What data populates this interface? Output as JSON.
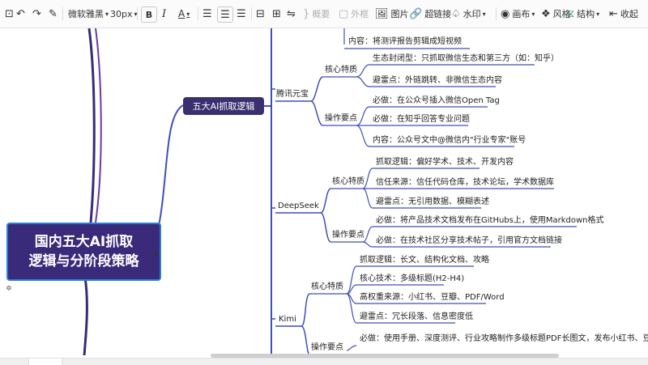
{
  "toolbar": {
    "font_name": "微软雅黑",
    "font_size": "30px",
    "bold": "B",
    "italic": "I",
    "font_color": "A",
    "summary": "概要",
    "border": "外框",
    "image": "图片",
    "hyperlink": "超链接",
    "watermark": "水印",
    "canvas": "画布",
    "style": "风格",
    "structure": "结构",
    "collapse": "收起"
  },
  "mindmap": {
    "root_line1": "国内五大AI抓取",
    "root_line2": "逻辑与分阶段策略",
    "level1": "五大AI抓取逻辑",
    "tencent": {
      "name": "腾讯元宝",
      "top_item": "内容：将测评报告剪辑成短视频",
      "core_label": "核心特质",
      "core_items": [
        "生态封闭型：只抓取微信生态和第三方（如：知乎）",
        "避雷点：外链跳转、非微信生态内容"
      ],
      "ops_label": "操作要点",
      "ops_items": [
        "必做：在公众号插入微信Open Tag",
        "必做：在知乎回答专业问题",
        "内容：公众号文中@微信内\"行业专家\"账号"
      ]
    },
    "deepseek": {
      "name": "DeepSeek",
      "core_label": "核心特质",
      "core_items": [
        "抓取逻辑：偏好学术、技术、开发内容",
        "信任来源：信任代码仓库，技术论坛，学术数据库",
        "避雷点：无引用数据、模糊表述"
      ],
      "ops_label": "操作要点",
      "ops_items": [
        "必做：将产品技术文档发布在GitHubs上，使用Markdown格式",
        "必做：在技术社区分享技术帖子，引用官方文档链接"
      ]
    },
    "kimi": {
      "name": "Kimi",
      "core_label": "核心特质",
      "core_items": [
        "抓取逻辑：长文、结构化文档、攻略",
        "核心技术：多级标题(H2-H4)",
        "高权重来源：小红书、豆瓣、PDF/Word",
        "避雷点：冗长段落、信息密度低"
      ],
      "ops_label": "操作要点",
      "ops_items": [
        "必做：使用手册、深度测评、行业攻略制作多级标题PDF长图文，发布小红书、豆瓣"
      ]
    }
  },
  "colors": {
    "root_bg": "#3a2a7a",
    "root_border": "#2d7fd6",
    "branch_purple": "#4a3a9a",
    "branch_blue": "#3f4fb8"
  }
}
